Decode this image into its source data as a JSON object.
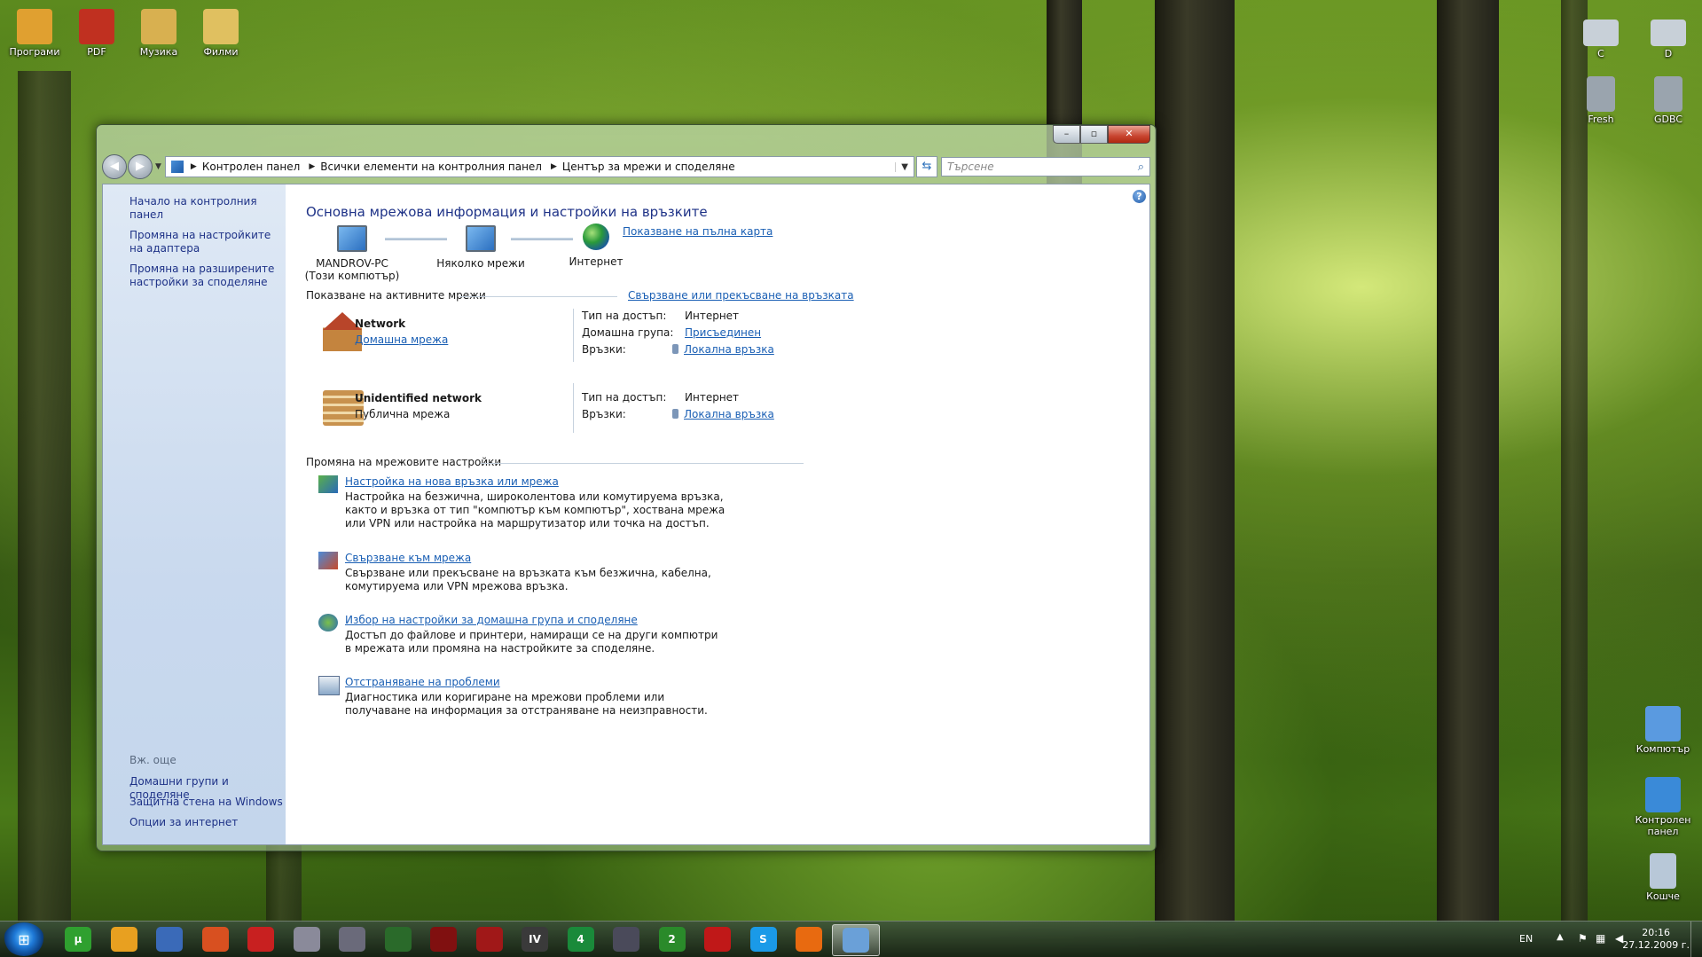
{
  "desktop": {
    "icons_left": [
      {
        "label": "Програми",
        "color": "#e0a030"
      },
      {
        "label": "PDF",
        "color": "#c03020"
      },
      {
        "label": "Музика",
        "color": "#d8b050"
      },
      {
        "label": "Филми",
        "color": "#e0c060"
      }
    ],
    "icons_right_top": [
      {
        "label": "C",
        "color": "#c8d0d8"
      },
      {
        "label": "D",
        "color": "#c8d0d8"
      },
      {
        "label": "Fresh",
        "color": "#9aa4ae"
      },
      {
        "label": "GDBC",
        "color": "#9aa4ae"
      }
    ],
    "icons_right_bottom": [
      {
        "label": "Компютър",
        "color": "#5a9ae0"
      },
      {
        "label": "Контролен панел",
        "color": "#3a8ad8"
      },
      {
        "label": "Кошче",
        "color": "#b8c8d8"
      }
    ]
  },
  "window": {
    "address": {
      "segments": [
        "Контролен панел",
        "Всички елементи на контролния панел",
        "Център за мрежи и споделяне"
      ]
    },
    "search_placeholder": "Търсене",
    "sidebar": {
      "home": "Начало на контролния панел",
      "link_adapter": "Промяна на настройките на адаптера",
      "link_sharing": "Промяна на разширените настройки за споделяне",
      "see_also": "Вж. още",
      "see_links": [
        "Домашни групи и споделяне",
        "Защитна стена на Windows",
        "Опции за интернет"
      ]
    },
    "main": {
      "title": "Основна мрежова информация и настройки на връзките",
      "full_map": "Показване на пълна карта",
      "map": {
        "computer_name": "MANDROV-PC",
        "computer_sub": "(Този компютър)",
        "middle": "Няколко мрежи",
        "internet": "Интернет"
      },
      "active_header": "Показване на активните мрежи",
      "connect_link": "Свързване или прекъсване на връзката",
      "networks": [
        {
          "name": "Network",
          "type": "Домашна мрежа",
          "access_label": "Тип на достъп:",
          "access": "Интернет",
          "homegroup_label": "Домашна група:",
          "homegroup": "Присъединен",
          "conn_label": "Връзки:",
          "conn": "Локална връзка"
        },
        {
          "name": "Unidentified network",
          "type": "Публична мрежа",
          "access_label": "Тип на достъп:",
          "access": "Интернет",
          "conn_label": "Връзки:",
          "conn": "Локална връзка"
        }
      ],
      "change_header": "Промяна на мрежовите настройки",
      "tasks": [
        {
          "title": "Настройка на нова връзка или мрежа",
          "desc": "Настройка на безжична, широколентова или комутируема връзка, както и връзка от тип \"компютър към компютър\", хоствана мрежа или VPN или настройка на маршрутизатор или точка на достъп."
        },
        {
          "title": "Свързване към мрежа",
          "desc": "Свързване или прекъсване на връзката към безжична, кабелна, комутируема или VPN мрежова връзка."
        },
        {
          "title": "Избор на настройки за домашна група и споделяне",
          "desc": "Достъп до файлове и принтери, намиращи се на други компютри в мрежата или промяна на настройките за споделяне."
        },
        {
          "title": "Отстраняване на проблеми",
          "desc": "Диагностика или коригиране на мрежови проблеми или получаване на информация за отстраняване на неизправности."
        }
      ]
    }
  },
  "taskbar": {
    "apps": [
      {
        "label": "µ",
        "color": "#2fa02f"
      },
      {
        "label": "",
        "color": "#e8a020"
      },
      {
        "label": "",
        "color": "#3a6ab8"
      },
      {
        "label": "",
        "color": "#d85020"
      },
      {
        "label": "",
        "color": "#c82020"
      },
      {
        "label": "",
        "color": "#8a8a9a"
      },
      {
        "label": "",
        "color": "#6a6a7a"
      },
      {
        "label": "",
        "color": "#2a6a2a"
      },
      {
        "label": "",
        "color": "#801010"
      },
      {
        "label": "",
        "color": "#a01818"
      },
      {
        "label": "IV",
        "color": "#3a3a3a"
      },
      {
        "label": "4",
        "color": "#1a8a3a"
      },
      {
        "label": "",
        "color": "#4a4a5a"
      },
      {
        "label": "2",
        "color": "#2a8a2a"
      },
      {
        "label": "",
        "color": "#c01818"
      },
      {
        "label": "S",
        "color": "#1a9ae8"
      },
      {
        "label": "",
        "color": "#e86a10"
      },
      {
        "label": "",
        "color": "#6aa0d8"
      }
    ],
    "tray": {
      "lang": "EN",
      "time": "20:16",
      "date": "27.12.2009 г."
    }
  }
}
